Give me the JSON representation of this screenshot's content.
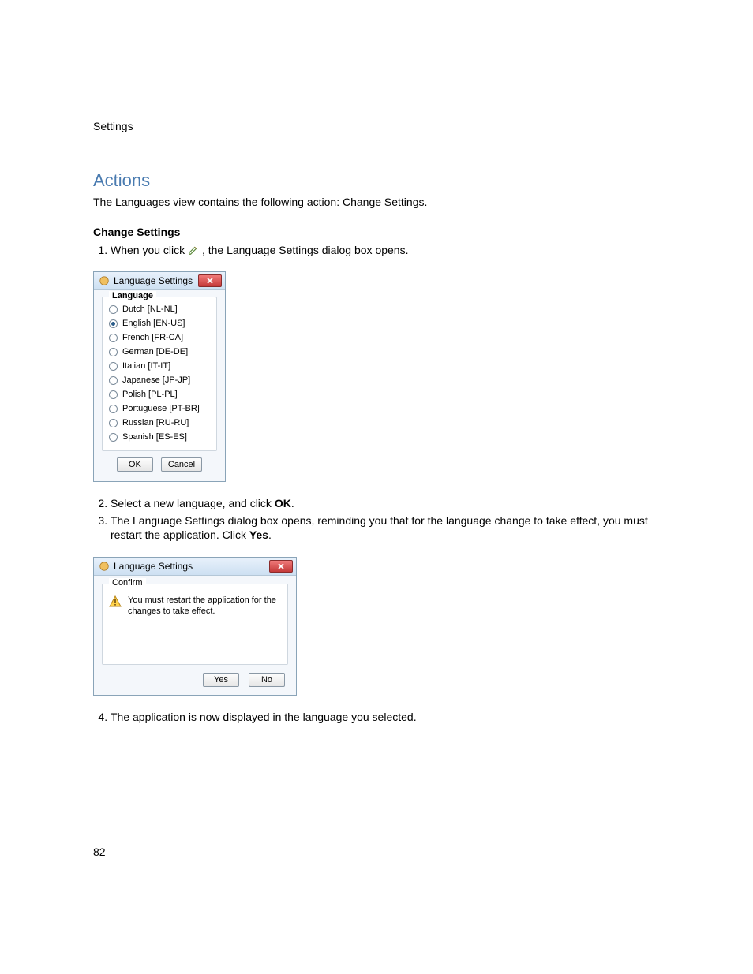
{
  "header": "Settings",
  "heading": "Actions",
  "intro": "The Languages view contains the following action: Change Settings.",
  "subheading": "Change Settings",
  "step1_pre": "When you click ",
  "step1_post": " , the Language Settings dialog box opens.",
  "step2_pre": "Select a new language, and click ",
  "step2_bold": "OK",
  "step2_post": ".",
  "step3_pre": "The Language Settings dialog box opens, reminding you that for the language change to take effect, you must restart the application. Click ",
  "step3_bold": "Yes",
  "step3_post": ".",
  "step4": "The application is now displayed in the language you selected.",
  "dialog1": {
    "title": "Language Settings",
    "groupLabel": "Language",
    "options": [
      {
        "label": "Dutch [NL-NL]",
        "selected": false
      },
      {
        "label": "English [EN-US]",
        "selected": true
      },
      {
        "label": "French [FR-CA]",
        "selected": false
      },
      {
        "label": "German [DE-DE]",
        "selected": false
      },
      {
        "label": "Italian [IT-IT]",
        "selected": false
      },
      {
        "label": "Japanese [JP-JP]",
        "selected": false
      },
      {
        "label": "Polish [PL-PL]",
        "selected": false
      },
      {
        "label": "Portuguese [PT-BR]",
        "selected": false
      },
      {
        "label": "Russian [RU-RU]",
        "selected": false
      },
      {
        "label": "Spanish [ES-ES]",
        "selected": false
      }
    ],
    "okLabel": "OK",
    "cancelLabel": "Cancel"
  },
  "dialog2": {
    "title": "Language Settings",
    "groupLabel": "Confirm",
    "message": "You must restart the application for the changes to take effect.",
    "yesLabel": "Yes",
    "noLabel": "No"
  },
  "pageNumber": "82"
}
